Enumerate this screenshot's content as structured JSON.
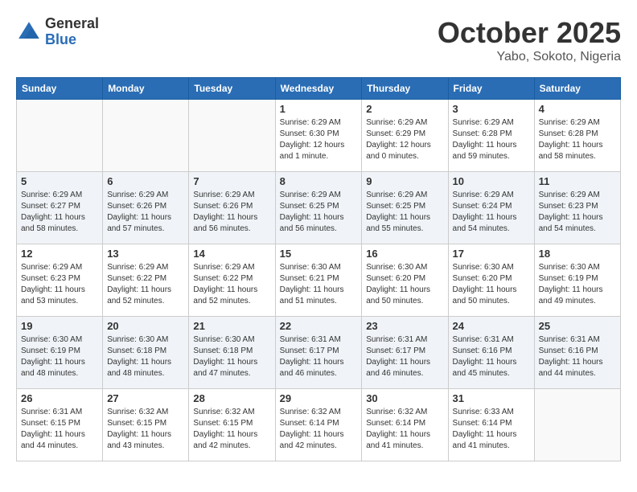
{
  "header": {
    "logo_general": "General",
    "logo_blue": "Blue",
    "month": "October 2025",
    "location": "Yabo, Sokoto, Nigeria"
  },
  "weekdays": [
    "Sunday",
    "Monday",
    "Tuesday",
    "Wednesday",
    "Thursday",
    "Friday",
    "Saturday"
  ],
  "weeks": [
    [
      {
        "day": "",
        "info": ""
      },
      {
        "day": "",
        "info": ""
      },
      {
        "day": "",
        "info": ""
      },
      {
        "day": "1",
        "info": "Sunrise: 6:29 AM\nSunset: 6:30 PM\nDaylight: 12 hours\nand 1 minute."
      },
      {
        "day": "2",
        "info": "Sunrise: 6:29 AM\nSunset: 6:29 PM\nDaylight: 12 hours\nand 0 minutes."
      },
      {
        "day": "3",
        "info": "Sunrise: 6:29 AM\nSunset: 6:28 PM\nDaylight: 11 hours\nand 59 minutes."
      },
      {
        "day": "4",
        "info": "Sunrise: 6:29 AM\nSunset: 6:28 PM\nDaylight: 11 hours\nand 58 minutes."
      }
    ],
    [
      {
        "day": "5",
        "info": "Sunrise: 6:29 AM\nSunset: 6:27 PM\nDaylight: 11 hours\nand 58 minutes."
      },
      {
        "day": "6",
        "info": "Sunrise: 6:29 AM\nSunset: 6:26 PM\nDaylight: 11 hours\nand 57 minutes."
      },
      {
        "day": "7",
        "info": "Sunrise: 6:29 AM\nSunset: 6:26 PM\nDaylight: 11 hours\nand 56 minutes."
      },
      {
        "day": "8",
        "info": "Sunrise: 6:29 AM\nSunset: 6:25 PM\nDaylight: 11 hours\nand 56 minutes."
      },
      {
        "day": "9",
        "info": "Sunrise: 6:29 AM\nSunset: 6:25 PM\nDaylight: 11 hours\nand 55 minutes."
      },
      {
        "day": "10",
        "info": "Sunrise: 6:29 AM\nSunset: 6:24 PM\nDaylight: 11 hours\nand 54 minutes."
      },
      {
        "day": "11",
        "info": "Sunrise: 6:29 AM\nSunset: 6:23 PM\nDaylight: 11 hours\nand 54 minutes."
      }
    ],
    [
      {
        "day": "12",
        "info": "Sunrise: 6:29 AM\nSunset: 6:23 PM\nDaylight: 11 hours\nand 53 minutes."
      },
      {
        "day": "13",
        "info": "Sunrise: 6:29 AM\nSunset: 6:22 PM\nDaylight: 11 hours\nand 52 minutes."
      },
      {
        "day": "14",
        "info": "Sunrise: 6:29 AM\nSunset: 6:22 PM\nDaylight: 11 hours\nand 52 minutes."
      },
      {
        "day": "15",
        "info": "Sunrise: 6:30 AM\nSunset: 6:21 PM\nDaylight: 11 hours\nand 51 minutes."
      },
      {
        "day": "16",
        "info": "Sunrise: 6:30 AM\nSunset: 6:20 PM\nDaylight: 11 hours\nand 50 minutes."
      },
      {
        "day": "17",
        "info": "Sunrise: 6:30 AM\nSunset: 6:20 PM\nDaylight: 11 hours\nand 50 minutes."
      },
      {
        "day": "18",
        "info": "Sunrise: 6:30 AM\nSunset: 6:19 PM\nDaylight: 11 hours\nand 49 minutes."
      }
    ],
    [
      {
        "day": "19",
        "info": "Sunrise: 6:30 AM\nSunset: 6:19 PM\nDaylight: 11 hours\nand 48 minutes."
      },
      {
        "day": "20",
        "info": "Sunrise: 6:30 AM\nSunset: 6:18 PM\nDaylight: 11 hours\nand 48 minutes."
      },
      {
        "day": "21",
        "info": "Sunrise: 6:30 AM\nSunset: 6:18 PM\nDaylight: 11 hours\nand 47 minutes."
      },
      {
        "day": "22",
        "info": "Sunrise: 6:31 AM\nSunset: 6:17 PM\nDaylight: 11 hours\nand 46 minutes."
      },
      {
        "day": "23",
        "info": "Sunrise: 6:31 AM\nSunset: 6:17 PM\nDaylight: 11 hours\nand 46 minutes."
      },
      {
        "day": "24",
        "info": "Sunrise: 6:31 AM\nSunset: 6:16 PM\nDaylight: 11 hours\nand 45 minutes."
      },
      {
        "day": "25",
        "info": "Sunrise: 6:31 AM\nSunset: 6:16 PM\nDaylight: 11 hours\nand 44 minutes."
      }
    ],
    [
      {
        "day": "26",
        "info": "Sunrise: 6:31 AM\nSunset: 6:15 PM\nDaylight: 11 hours\nand 44 minutes."
      },
      {
        "day": "27",
        "info": "Sunrise: 6:32 AM\nSunset: 6:15 PM\nDaylight: 11 hours\nand 43 minutes."
      },
      {
        "day": "28",
        "info": "Sunrise: 6:32 AM\nSunset: 6:15 PM\nDaylight: 11 hours\nand 42 minutes."
      },
      {
        "day": "29",
        "info": "Sunrise: 6:32 AM\nSunset: 6:14 PM\nDaylight: 11 hours\nand 42 minutes."
      },
      {
        "day": "30",
        "info": "Sunrise: 6:32 AM\nSunset: 6:14 PM\nDaylight: 11 hours\nand 41 minutes."
      },
      {
        "day": "31",
        "info": "Sunrise: 6:33 AM\nSunset: 6:14 PM\nDaylight: 11 hours\nand 41 minutes."
      },
      {
        "day": "",
        "info": ""
      }
    ]
  ]
}
